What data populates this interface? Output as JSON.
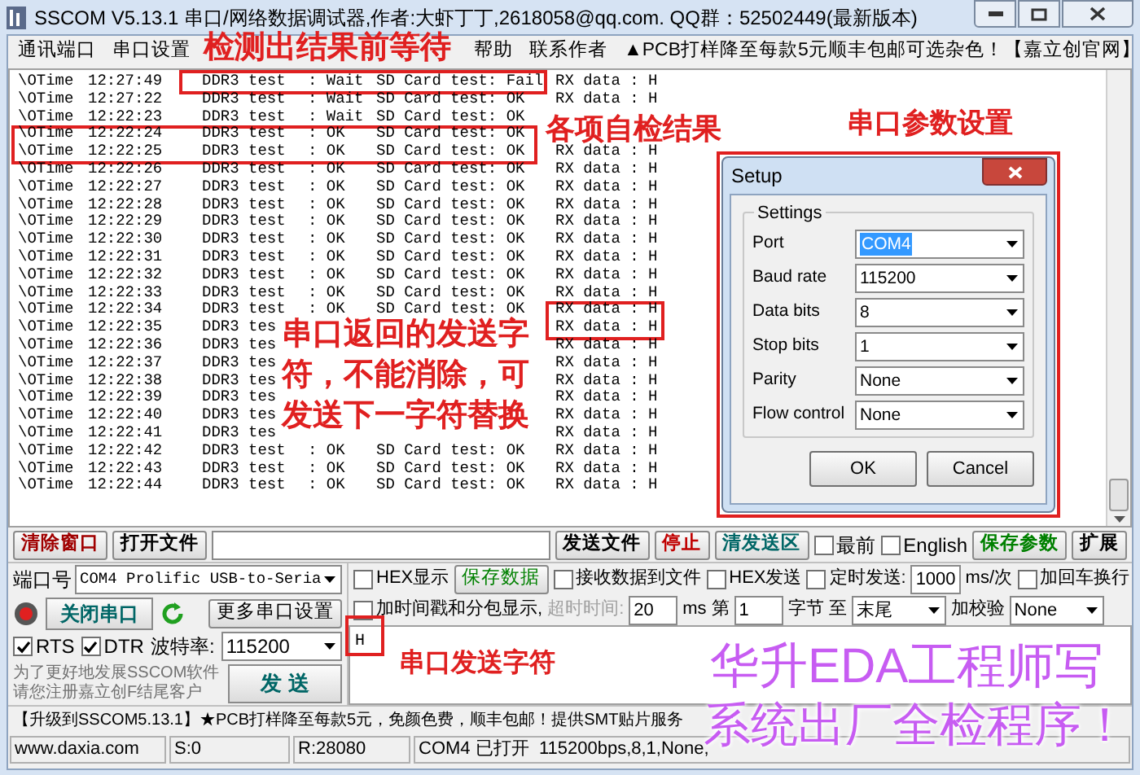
{
  "window": {
    "title": "SSCOM V5.13.1 串口/网络数据调试器,作者:大虾丁丁,2618058@qq.com. QQ群：52502449(最新版本)"
  },
  "menu": {
    "items": [
      "通讯端口",
      "串口设置",
      "帮助",
      "联系作者",
      "▲PCB打样降至每款5元顺丰包邮可选杂色！【嘉立创官网】"
    ]
  },
  "terminal": {
    "lines": [
      {
        "label": "\\OTime",
        "time": "12:27:49",
        "device": "DDR3 test",
        "status": ": Wait",
        "sd": "SD Card test: Fail",
        "rx": "RX data : H"
      },
      {
        "label": "\\OTime",
        "time": "12:27:22",
        "device": "DDR3 test",
        "status": ": Wait",
        "sd": "SD Card test: OK",
        "rx": "RX data : H"
      },
      {
        "label": "\\OTime",
        "time": "12:22:23",
        "device": "DDR3 test",
        "status": ": Wait",
        "sd": "SD Card test: OK"
      },
      {
        "label": "\\OTime",
        "time": "12:22:24",
        "device": "DDR3 test",
        "status": ": OK",
        "sd": "SD Card test: OK"
      },
      {
        "label": "\\OTime",
        "time": "12:22:25",
        "device": "DDR3 test",
        "status": ": OK",
        "sd": "SD Card test: OK",
        "rx": "RX data : H"
      },
      {
        "label": "\\OTime",
        "time": "12:22:26",
        "device": "DDR3 test",
        "status": ": OK",
        "sd": "SD Card test: OK",
        "rx": "RX data : H"
      },
      {
        "label": "\\OTime",
        "time": "12:22:27",
        "device": "DDR3 test",
        "status": ": OK",
        "sd": "SD Card test: OK",
        "rx": "RX data : H"
      },
      {
        "label": "\\OTime",
        "time": "12:22:28",
        "device": "DDR3 test",
        "status": ": OK",
        "sd": "SD Card test: OK",
        "rx": "RX data : H"
      },
      {
        "label": "\\OTime",
        "time": "12:22:29",
        "device": "DDR3 test",
        "status": ": OK",
        "sd": "SD Card test: OK",
        "rx": "RX data : H"
      },
      {
        "label": "\\OTime",
        "time": "12:22:30",
        "device": "DDR3 test",
        "status": ": OK",
        "sd": "SD Card test: OK",
        "rx": "RX data : H"
      },
      {
        "label": "\\OTime",
        "time": "12:22:31",
        "device": "DDR3 test",
        "status": ": OK",
        "sd": "SD Card test: OK",
        "rx": "RX data : H"
      },
      {
        "label": "\\OTime",
        "time": "12:22:32",
        "device": "DDR3 test",
        "status": ": OK",
        "sd": "SD Card test: OK",
        "rx": "RX data : H"
      },
      {
        "label": "\\OTime",
        "time": "12:22:33",
        "device": "DDR3 test",
        "status": ": OK",
        "sd": "SD Card test: OK",
        "rx": "RX data : H"
      },
      {
        "label": "\\OTime",
        "time": "12:22:34",
        "device": "DDR3 test",
        "status": ": OK",
        "sd": "SD Card test: OK",
        "rx": "RX data : H"
      },
      {
        "label": "\\OTime",
        "time": "12:22:35",
        "device": "DDR3 tes",
        "rx": "RX data : H"
      },
      {
        "label": "\\OTime",
        "time": "12:22:36",
        "device": "DDR3 tes",
        "rx": "RX data : H"
      },
      {
        "label": "\\OTime",
        "time": "12:22:37",
        "device": "DDR3 tes",
        "rx": "RX data : H"
      },
      {
        "label": "\\OTime",
        "time": "12:22:38",
        "device": "DDR3 tes",
        "rx": "RX data : H"
      },
      {
        "label": "\\OTime",
        "time": "12:22:39",
        "device": "DDR3 tes",
        "rx": "RX data : H"
      },
      {
        "label": "\\OTime",
        "time": "12:22:40",
        "device": "DDR3 tes",
        "rx": "RX data : H"
      },
      {
        "label": "\\OTime",
        "time": "12:22:41",
        "device": "DDR3 tes",
        "rx": "RX data : H"
      },
      {
        "label": "\\OTime",
        "time": "12:22:42",
        "device": "DDR3 test",
        "status": ": OK",
        "sd": "SD Card test: OK",
        "rx": "RX data : H"
      },
      {
        "label": "\\OTime",
        "time": "12:22:43",
        "device": "DDR3 test",
        "status": ": OK",
        "sd": "SD Card test: OK",
        "rx": "RX data : H"
      },
      {
        "label": "\\OTime",
        "time": "12:22:44",
        "device": "DDR3 test",
        "status": ": OK",
        "sd": "SD Card test: OK",
        "rx": "RX data : H"
      }
    ]
  },
  "setup_dialog": {
    "title": "Setup",
    "group": "Settings",
    "fields": [
      {
        "label": "Port",
        "value": "COM4",
        "selected": true
      },
      {
        "label": "Baud rate",
        "value": "115200",
        "selected": false
      },
      {
        "label": "Data bits",
        "value": "8",
        "selected": false
      },
      {
        "label": "Stop bits",
        "value": "1",
        "selected": false
      },
      {
        "label": "Parity",
        "value": "None",
        "selected": false
      },
      {
        "label": "Flow control",
        "value": "None",
        "selected": false
      }
    ],
    "buttons": [
      "OK",
      "Cancel"
    ]
  },
  "toolbar": {
    "items": [
      {
        "kind": "button",
        "label": "清除窗口",
        "color": "#a00000"
      },
      {
        "kind": "button",
        "label": "打开文件",
        "color": "#000000"
      },
      {
        "kind": "field"
      },
      {
        "kind": "button",
        "label": "发送文件",
        "color": "#000000"
      },
      {
        "kind": "button",
        "label": "停止",
        "color": "#c00000"
      },
      {
        "kind": "button",
        "label": "清发送区",
        "color": "#006666"
      },
      {
        "kind": "checkbox",
        "label": "最前",
        "checked": false
      },
      {
        "kind": "checkbox",
        "label": "English",
        "checked": false
      },
      {
        "kind": "button",
        "label": "保存参数",
        "color": "#008000"
      },
      {
        "kind": "button",
        "label": "扩展",
        "color": "#000000"
      }
    ]
  },
  "port_panel": {
    "port_label": "端口号",
    "port_value": "COM4 Prolific USB-to-Seria",
    "open_button": "关闭串口",
    "more_button": "更多串口设置",
    "rts": {
      "label": "RTS",
      "checked": true
    },
    "dtr": {
      "label": "DTR",
      "checked": true
    },
    "baud_label": "波特率:",
    "baud_value": "115200",
    "notice": "为了更好地发展SSCOM软件请您注册嘉立创F结尾客户",
    "send_button": "发 送"
  },
  "options": {
    "row_1": [
      {
        "kind": "checkbox",
        "label": "HEX显示",
        "checked": false
      },
      {
        "kind": "button",
        "label": "保存数据"
      },
      {
        "kind": "checkbox",
        "label": "接收数据到文件",
        "checked": false
      },
      {
        "kind": "checkbox",
        "label": "HEX发送",
        "checked": false
      },
      {
        "kind": "checkbox",
        "label": "定时发送:",
        "checked": false
      },
      {
        "kind": "field",
        "value": "1000"
      },
      {
        "kind": "text",
        "label": "ms/次",
        "disabled": false
      },
      {
        "kind": "checkbox",
        "label": "加回车换行",
        "checked": false
      }
    ],
    "row_2": [
      {
        "kind": "checkbox",
        "label": "加时间戳和分包显示,",
        "checked": false
      },
      {
        "kind": "text",
        "label": "超时时间:",
        "disabled": true
      },
      {
        "kind": "field",
        "value": "20"
      },
      {
        "kind": "text",
        "label": "ms",
        "disabled": false
      },
      {
        "kind": "text",
        "label": "第",
        "disabled": false
      },
      {
        "kind": "field",
        "value": "1"
      },
      {
        "kind": "text",
        "label": "字节",
        "disabled": false
      },
      {
        "kind": "text",
        "label": "至",
        "disabled": false
      },
      {
        "kind": "select",
        "value": "末尾"
      },
      {
        "kind": "text",
        "label": "加校验",
        "disabled": false
      },
      {
        "kind": "select",
        "value": "None"
      }
    ]
  },
  "send_box": {
    "value": "H"
  },
  "ticker": "【升级到SSCOM5.13.1】★PCB打样降至每款5元，免颜色费，顺丰包邮！提供SMT贴片服务",
  "status_bar": [
    "www.daxia.com",
    "S:0",
    "R:28080",
    "COM4 已打开  115200bps,8,1,None,"
  ],
  "annotations": {
    "notes": [
      "检测出结果前等待",
      "各项自检结果",
      "串口参数设置",
      "串口返回的发送字符，不能消除，可发送下一字符替换",
      "串口发送字符"
    ],
    "banner": [
      "华升EDA工程师写",
      "系统出厂全检程序！"
    ]
  }
}
